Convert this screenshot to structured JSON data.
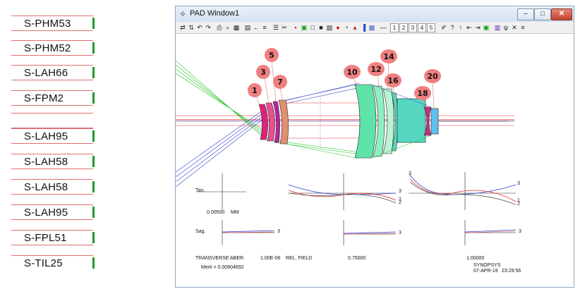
{
  "glass_list": [
    "S-PHM53",
    "S-PHM52",
    "S-LAH66",
    "S-FPM2",
    "",
    "S-LAH95",
    "S-LAH58",
    "S-LAH58",
    "S-LAH95",
    "S-FPL51",
    "S-TIL25"
  ],
  "window": {
    "title": "PAD Window1",
    "buttons": {
      "minimize": "‒",
      "maximize": "□",
      "close": "✕"
    }
  },
  "toolbar": {
    "icons": [
      "⇄",
      "⇅",
      "↶",
      "↷",
      "⎙",
      "⌕",
      "▦",
      "▤",
      "←",
      "≡",
      "☰",
      "✂",
      "▪",
      "▣",
      "□",
      "■",
      "▧",
      "●",
      "◔",
      "▲",
      "▐",
      "▩",
      "—"
    ],
    "numbers": [
      "1",
      "2",
      "3",
      "4",
      "5"
    ],
    "icons_right": [
      "✐",
      "?",
      "↑",
      "⇤",
      "⇥",
      "▣",
      "▥",
      "ψ",
      "✕",
      "≡"
    ]
  },
  "bubbles": [
    "1",
    "3",
    "5",
    "7",
    "10",
    "12",
    "14",
    "16",
    "18",
    "20"
  ],
  "aberration": {
    "tan_label": "Tan.",
    "sag_label": "Sag.",
    "scale_value": "0.00500",
    "scale_unit": "MM",
    "title": "TRANSVERSE ABER.",
    "wavelength": "1.00E-06",
    "rel_field_label": "REL. FIELD",
    "field_mid": "0.75000",
    "field_full": "1.00000",
    "merit": "Merit = 0.00904692",
    "curve_labels": [
      "3",
      "1",
      "2"
    ],
    "sag_curve_label": "3"
  },
  "footer": {
    "brand": "SYNOPSYS",
    "date": "07-APR-19",
    "time": "23:29:56"
  },
  "colors": {
    "lens_pink": "#e0207a",
    "lens_green": "#5ee3a8",
    "lens_teal": "#55d7c0",
    "ray_red": "#e03030",
    "ray_blue": "#3040d0",
    "ray_green": "#20c020",
    "bubble": "#f08080"
  }
}
